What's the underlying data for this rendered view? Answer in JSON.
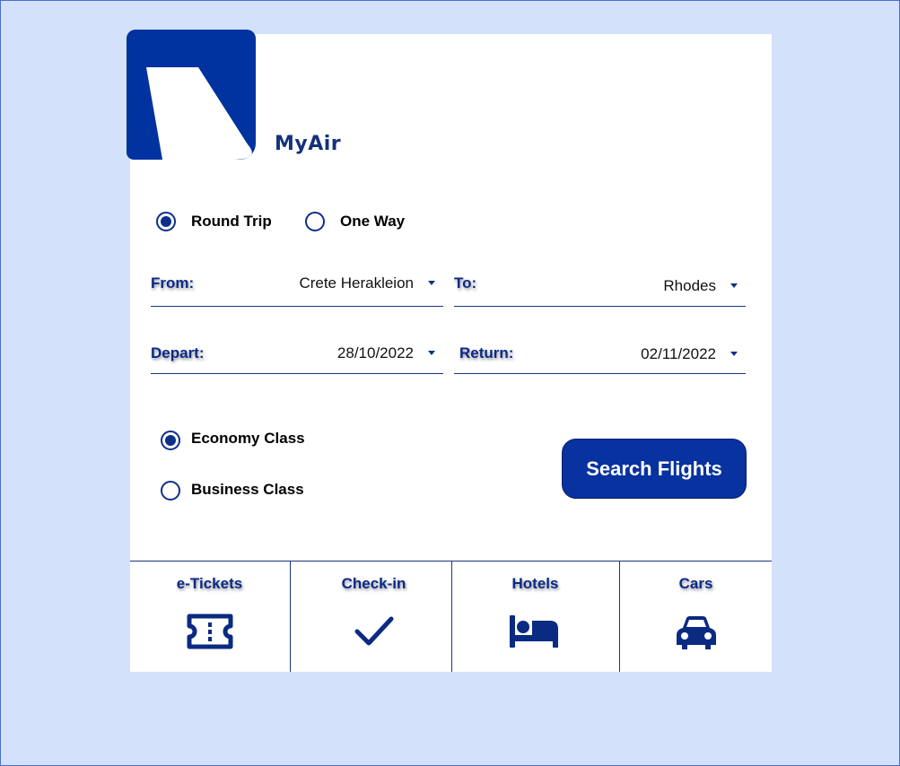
{
  "brand": {
    "name": "MyAir",
    "color": "#0032a0"
  },
  "trip_type": {
    "options": [
      {
        "label": "Round Trip",
        "selected": true
      },
      {
        "label": "One Way",
        "selected": false
      }
    ]
  },
  "fields": {
    "from": {
      "label": "From:",
      "value": "Crete Herakleion"
    },
    "to": {
      "label": "To:",
      "value": "Rhodes"
    },
    "depart": {
      "label": "Depart:",
      "value": "28/10/2022"
    },
    "return": {
      "label": "Return:",
      "value": "02/11/2022"
    }
  },
  "cabin_class": {
    "options": [
      {
        "label": "Economy Class",
        "selected": true
      },
      {
        "label": "Business Class",
        "selected": false
      }
    ]
  },
  "search_button": {
    "label": "Search Flights"
  },
  "bottom_nav": [
    {
      "label": "e-Tickets",
      "icon": "ticket-icon"
    },
    {
      "label": "Check-in",
      "icon": "checkmark-icon"
    },
    {
      "label": "Hotels",
      "icon": "bed-icon"
    },
    {
      "label": "Cars",
      "icon": "car-icon"
    }
  ]
}
